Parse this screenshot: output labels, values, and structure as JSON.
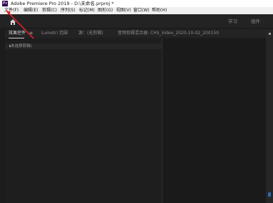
{
  "window": {
    "app_icon": "Pr",
    "title": "Adobe Premiere Pro 2019 - D:\\未命名.prproj *"
  },
  "menu": [
    "文件(F)",
    "编辑(E)",
    "剪辑(C)",
    "序列(S)",
    "标记(M)",
    "图形(G)",
    "视图(V)",
    "窗口(W)",
    "帮助(H)"
  ],
  "workspace": {
    "home_icon": "home-icon",
    "tabs": [
      "学习",
      "组件"
    ]
  },
  "panel_tabs": {
    "effect_controls": "效果控件",
    "menu_glyph": "≡",
    "lumetri": "Lumetri 范围",
    "source": "源：(无剪辑)",
    "audio_mixer": "音频剪辑混合器: CHS_Video_2020-10-02_200150"
  },
  "clip": {
    "label": "(未选择剪辑)",
    "arrow": "▸"
  },
  "colors": {
    "annotation_arrow": "#e8202a",
    "selection_accent": "#2b6cb0"
  }
}
